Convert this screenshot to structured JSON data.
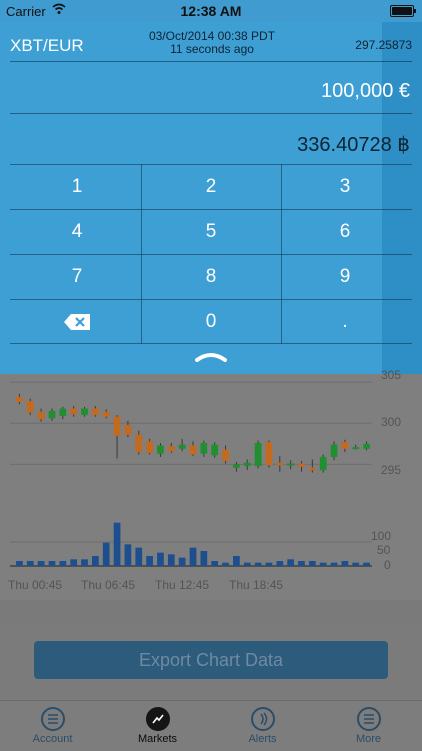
{
  "status": {
    "carrier": "Carrier",
    "time": "12:38 AM"
  },
  "header": {
    "pair": "XBT/EUR",
    "date": "03/Oct/2014 00:38 PDT",
    "ago": "11 seconds ago",
    "price": "297.25873"
  },
  "converter": {
    "fiat_value": "100,000 €",
    "btc_value": "336.40728 ฿"
  },
  "keypad": {
    "keys": [
      "1",
      "2",
      "3",
      "4",
      "5",
      "6",
      "7",
      "8",
      "9",
      "backspace",
      "0",
      "."
    ]
  },
  "chart_data": {
    "type": "candlestick",
    "y_ticks": [
      "305",
      "300",
      "295"
    ],
    "volume_ticks": [
      "100",
      "50",
      "0"
    ],
    "x_ticks": [
      "Thu 00:45",
      "Thu 06:45",
      "Thu 12:45",
      "Thu 18:45"
    ],
    "ylim": [
      292,
      306
    ],
    "vol_max": 150,
    "up_color": "#1f8f2f",
    "down_color": "#c46a1f",
    "volume_color": "#1d4f8f",
    "candles": [
      {
        "o": 303.2,
        "c": 302.6,
        "h": 303.6,
        "l": 302.3
      },
      {
        "o": 302.7,
        "c": 301.3,
        "h": 303.0,
        "l": 301.0
      },
      {
        "o": 301.4,
        "c": 300.5,
        "h": 301.8,
        "l": 300.2
      },
      {
        "o": 300.6,
        "c": 301.5,
        "h": 301.8,
        "l": 300.3
      },
      {
        "o": 300.9,
        "c": 301.8,
        "h": 302.0,
        "l": 300.5
      },
      {
        "o": 301.8,
        "c": 301.1,
        "h": 302.1,
        "l": 300.8
      },
      {
        "o": 301.0,
        "c": 301.8,
        "h": 302.0,
        "l": 300.8
      },
      {
        "o": 301.8,
        "c": 301.0,
        "h": 302.1,
        "l": 300.8
      },
      {
        "o": 301.4,
        "c": 300.8,
        "h": 301.7,
        "l": 300.6
      },
      {
        "o": 300.8,
        "c": 298.5,
        "h": 301.0,
        "l": 295.7
      },
      {
        "o": 299.8,
        "c": 298.6,
        "h": 300.3,
        "l": 298.3
      },
      {
        "o": 298.6,
        "c": 296.5,
        "h": 299.1,
        "l": 296.2
      },
      {
        "o": 297.8,
        "c": 296.4,
        "h": 298.1,
        "l": 296.2
      },
      {
        "o": 296.3,
        "c": 297.3,
        "h": 297.6,
        "l": 295.9
      },
      {
        "o": 297.2,
        "c": 296.6,
        "h": 297.6,
        "l": 296.4
      },
      {
        "o": 296.9,
        "c": 297.4,
        "h": 298.1,
        "l": 296.6
      },
      {
        "o": 297.3,
        "c": 296.2,
        "h": 297.8,
        "l": 296.0
      },
      {
        "o": 296.3,
        "c": 297.6,
        "h": 297.9,
        "l": 295.9
      },
      {
        "o": 296.1,
        "c": 297.4,
        "h": 297.7,
        "l": 295.8
      },
      {
        "o": 296.8,
        "c": 295.4,
        "h": 297.3,
        "l": 295.1
      },
      {
        "o": 294.6,
        "c": 295.0,
        "h": 295.3,
        "l": 294.1
      },
      {
        "o": 294.8,
        "c": 295.2,
        "h": 295.6,
        "l": 294.3
      },
      {
        "o": 294.8,
        "c": 297.6,
        "h": 297.9,
        "l": 294.5
      },
      {
        "o": 297.7,
        "c": 294.9,
        "h": 297.9,
        "l": 294.6
      },
      {
        "o": 295.2,
        "c": 294.9,
        "h": 296.0,
        "l": 294.1
      },
      {
        "o": 294.9,
        "c": 295.1,
        "h": 295.5,
        "l": 294.4
      },
      {
        "o": 295.1,
        "c": 294.7,
        "h": 295.4,
        "l": 294.1
      },
      {
        "o": 294.6,
        "c": 294.3,
        "h": 295.6,
        "l": 294.0
      },
      {
        "o": 294.3,
        "c": 295.9,
        "h": 296.2,
        "l": 294.0
      },
      {
        "o": 295.9,
        "c": 297.4,
        "h": 297.8,
        "l": 295.5
      },
      {
        "o": 297.7,
        "c": 296.9,
        "h": 298.0,
        "l": 296.5
      },
      {
        "o": 296.9,
        "c": 297.1,
        "h": 297.4,
        "l": 296.8
      },
      {
        "o": 296.9,
        "c": 297.5,
        "h": 297.8,
        "l": 296.7
      }
    ],
    "volumes": [
      15,
      15,
      15,
      15,
      15,
      20,
      20,
      30,
      70,
      130,
      65,
      55,
      30,
      40,
      35,
      25,
      55,
      45,
      15,
      10,
      30,
      10,
      10,
      10,
      15,
      20,
      15,
      15,
      10,
      10,
      15,
      10,
      10
    ]
  },
  "export": {
    "label": "Export Chart Data"
  },
  "tabs": [
    {
      "label": "Account",
      "icon": "list-icon",
      "active": false
    },
    {
      "label": "Markets",
      "icon": "trend-icon",
      "active": true
    },
    {
      "label": "Alerts",
      "icon": "alert-icon",
      "active": false
    },
    {
      "label": "More",
      "icon": "more-icon",
      "active": false
    }
  ]
}
